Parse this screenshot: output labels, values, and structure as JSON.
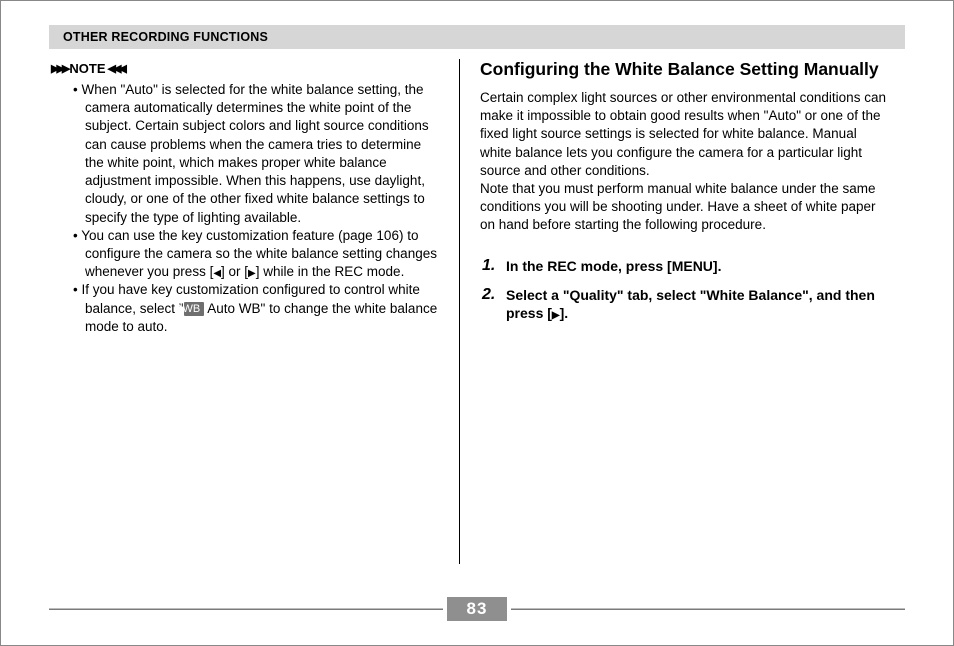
{
  "header": "OTHER RECORDING FUNCTIONS",
  "note_label": "NOTE",
  "bullets": {
    "b1a": "When \"Auto\" is selected for the white balance setting, the camera automatically determines the white point of the subject. Certain subject colors and light source conditions can cause problems when the camera tries to determine the white point, which makes proper white balance adjustment impossible. When this happens, use daylight, cloudy, or one of the other fixed white balance settings to specify the type of lighting available.",
    "b2a": "You can use the key customization feature (page 106) to configure the camera so the white balance setting changes whenever you press [",
    "b2b": "] or [",
    "b2c": "] while in the REC mode.",
    "b3a": "If you have key customization configured to control white balance, select \"",
    "awb": "AWB",
    "b3b": " Auto WB\" to change the white balance mode to auto."
  },
  "right": {
    "title": "Configuring the White Balance Setting Manually",
    "para1": "Certain complex light sources or other environmental conditions can make it impossible to obtain good results when \"Auto\" or one of the fixed light source settings is selected for white balance. Manual white balance lets you configure the camera for a particular light source and other conditions.",
    "para2": "Note that you must perform manual white balance under the same conditions you will be shooting under. Have a sheet of white paper on hand before starting the following procedure.",
    "steps": {
      "s1": "In the REC mode, press [MENU].",
      "s2a": "Select a \"Quality\" tab, select \"White Balance\", and then press [",
      "s2b": "]."
    }
  },
  "page_number": "83"
}
